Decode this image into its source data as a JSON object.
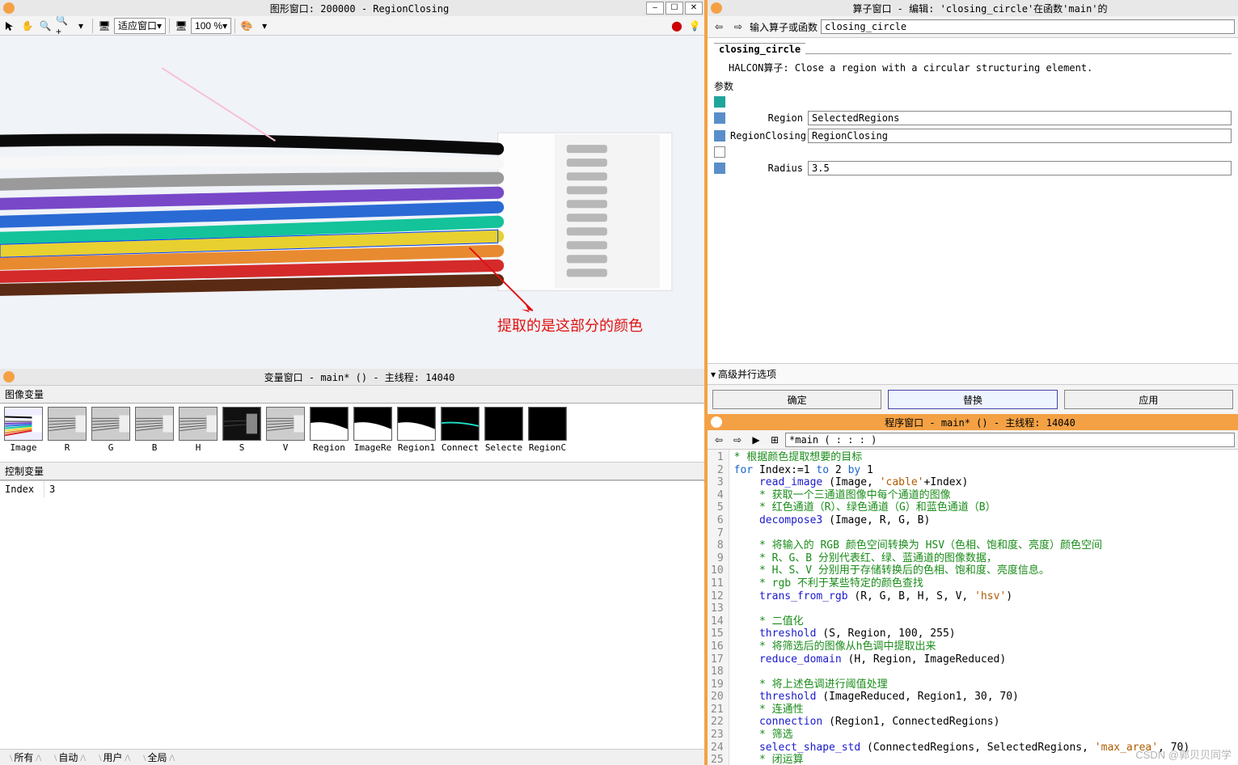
{
  "graphics_window": {
    "title": "图形窗口: 200000 - RegionClosing",
    "zoom_fit": "适应窗口",
    "zoom_pct": "100 %",
    "annotation": "提取的是这部分的颜色"
  },
  "var_window": {
    "title": "变量窗口 - main* () - 主线程: 14040",
    "section_images": "图像变量",
    "section_ctrl": "控制变量",
    "thumbs": [
      {
        "label": "Image"
      },
      {
        "label": "R"
      },
      {
        "label": "G"
      },
      {
        "label": "B"
      },
      {
        "label": "H"
      },
      {
        "label": "S"
      },
      {
        "label": "V"
      },
      {
        "label": "Region"
      },
      {
        "label": "ImageRe"
      },
      {
        "label": "Region1"
      },
      {
        "label": "Connect"
      },
      {
        "label": "Selecte"
      },
      {
        "label": "RegionC"
      }
    ],
    "ctrl_var_name": "Index",
    "ctrl_var_value": "3",
    "tabs": [
      "所有",
      "自动",
      "用户",
      "全局"
    ]
  },
  "operator_window": {
    "title": "算子窗口 - 编辑:  'closing_circle'在函数'main'的",
    "input_label": "输入算子或函数",
    "input_value": "closing_circle",
    "op_name": "closing_circle",
    "op_desc_prefix": "HALCON算子: ",
    "op_desc": "Close a region with a circular structuring element.",
    "params_header": "参数",
    "params": [
      {
        "label": "Region",
        "value": "SelectedRegions",
        "icon": "blue"
      },
      {
        "label": "RegionClosing",
        "value": "RegionClosing",
        "icon": "blue"
      },
      {
        "label": "Radius",
        "value": "3.5",
        "icon": "blue"
      }
    ],
    "advanced": "高级并行选项",
    "btn_ok": "确定",
    "btn_replace": "替换",
    "btn_apply": "应用"
  },
  "program_window": {
    "title": "程序窗口 - main* () - 主线程: 14040",
    "func_display": "*main ( : : : )",
    "code_lines": [
      {
        "n": 1,
        "t": "cmt",
        "text": "* 根据颜色提取想要的目标"
      },
      {
        "n": 2,
        "t": "code",
        "html": "<span class='kw'>for</span> Index:=1 <span class='kw'>to</span> 2 <span class='kw'>by</span> 1"
      },
      {
        "n": 3,
        "t": "code",
        "html": "    <span class='fn'>read_image</span> (Image, <span class='str'>'cable'</span>+Index)"
      },
      {
        "n": 4,
        "t": "cmt",
        "text": "    * 获取一个三通道图像中每个通道的图像"
      },
      {
        "n": 5,
        "t": "cmt",
        "text": "    * 红色通道（R）、绿色通道（G）和蓝色通道（B）"
      },
      {
        "n": 6,
        "t": "code",
        "html": "    <span class='fn'>decompose3</span> (Image, R, G, B)"
      },
      {
        "n": 7,
        "t": "blank",
        "text": ""
      },
      {
        "n": 8,
        "t": "cmt",
        "text": "    * 将输入的 RGB 颜色空间转换为 HSV（色相、饱和度、亮度）颜色空间"
      },
      {
        "n": 9,
        "t": "cmt",
        "text": "    * R、G、B 分别代表红、绿、蓝通道的图像数据，"
      },
      {
        "n": 10,
        "t": "cmt",
        "text": "    * H、S、V 分别用于存储转换后的色相、饱和度、亮度信息。"
      },
      {
        "n": 11,
        "t": "cmt",
        "text": "    * rgb 不利于某些特定的颜色查找"
      },
      {
        "n": 12,
        "t": "code",
        "html": "    <span class='fn'>trans_from_rgb</span> (R, G, B, H, S, V, <span class='str'>'hsv'</span>)"
      },
      {
        "n": 13,
        "t": "blank",
        "text": ""
      },
      {
        "n": 14,
        "t": "cmt",
        "text": "    * 二值化"
      },
      {
        "n": 15,
        "t": "code",
        "html": "    <span class='fn'>threshold</span> (S, Region, 100, 255)"
      },
      {
        "n": 16,
        "t": "cmt",
        "text": "    * 将筛选后的图像从h色调中提取出来"
      },
      {
        "n": 17,
        "t": "code",
        "html": "    <span class='fn'>reduce_domain</span> (H, Region, ImageReduced)"
      },
      {
        "n": 18,
        "t": "blank",
        "text": ""
      },
      {
        "n": 19,
        "t": "cmt",
        "text": "    * 将上述色调进行阈值处理"
      },
      {
        "n": 20,
        "t": "code",
        "html": "    <span class='fn'>threshold</span> (ImageReduced, Region1, 30, 70)"
      },
      {
        "n": 21,
        "t": "cmt",
        "text": "    * 连通性"
      },
      {
        "n": 22,
        "t": "code",
        "html": "    <span class='fn'>connection</span> (Region1, ConnectedRegions)"
      },
      {
        "n": 23,
        "t": "cmt",
        "text": "    * 筛选"
      },
      {
        "n": 24,
        "t": "code",
        "html": "    <span class='fn'>select_shape_std</span> (ConnectedRegions, SelectedRegions, <span class='str'>'max_area'</span>, 70)"
      },
      {
        "n": 25,
        "t": "cmt",
        "text": "    * 闭运算"
      }
    ],
    "watermark": "CSDN @郭贝贝同学"
  }
}
